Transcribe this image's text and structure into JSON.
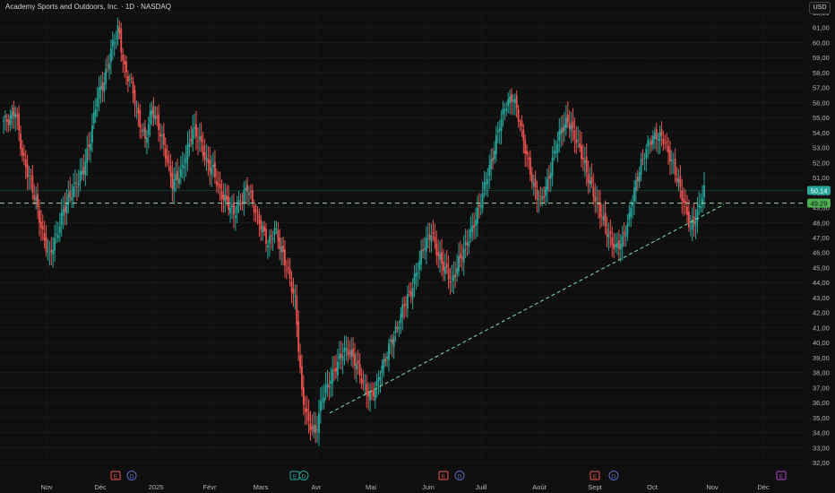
{
  "header": {
    "title": "Academy Sports and Outdoors, Inc. · 1D · NASDAQ",
    "currency_button": "USD"
  },
  "chart_data": {
    "type": "candlestick",
    "ylim": [
      32,
      62
    ],
    "y_ticks": [
      "32,00",
      "33,00",
      "34,00",
      "35,00",
      "36,00",
      "37,00",
      "38,00",
      "39,00",
      "40,00",
      "41,00",
      "42,00",
      "43,00",
      "44,00",
      "45,00",
      "46,00",
      "47,00",
      "48,00",
      "49,00",
      "50,00",
      "51,00",
      "52,00",
      "53,00",
      "54,00",
      "55,00",
      "56,00",
      "57,00",
      "58,00",
      "59,00",
      "60,00",
      "61,00",
      "62,00"
    ],
    "x_ticks": [
      "Nov",
      "Déc",
      "2025",
      "Févr",
      "Mars",
      "Avr",
      "Mai",
      "Juin",
      "Juill",
      "Août",
      "Sept",
      "Oct",
      "Nov",
      "Déc"
    ],
    "last_price_label": "50,14",
    "horizontal_level": {
      "value": 49.29,
      "label": "49,29"
    },
    "trendline": {
      "start_value": 35.3,
      "end_value": 49.2
    },
    "event_markers": [
      {
        "type": "E",
        "period": "Déc"
      },
      {
        "type": "D",
        "period": "Déc"
      },
      {
        "type": "E",
        "period": "Mars"
      },
      {
        "type": "D",
        "period": "Mars"
      },
      {
        "type": "E",
        "period": "Juin"
      },
      {
        "type": "D",
        "period": "Juin"
      },
      {
        "type": "E",
        "period": "Sept"
      },
      {
        "type": "D",
        "period": "Sept"
      },
      {
        "type": "E",
        "period": "Déc"
      }
    ],
    "price_path": [
      [
        54.8,
        55.5,
        52.5,
        51.0,
        49.4,
        47.2,
        45.6
      ],
      [
        47.0,
        48.8,
        49.8,
        50.6,
        51.6,
        53.6,
        56.5,
        57.4,
        59.5,
        60.9
      ],
      [
        58.2,
        57.3,
        55.0,
        53.5,
        55.6,
        54.4,
        52.6,
        50.6,
        51.2
      ],
      [
        52.4,
        54.2,
        53.5,
        52.0,
        51.5,
        50.0,
        49.4,
        48.6,
        49.4,
        50.4,
        49.0,
        47.8,
        46.6
      ],
      [
        47.6,
        46.2,
        44.6,
        42.8,
        36.6,
        34.6,
        34.0
      ],
      [
        36.4,
        37.3,
        38.4,
        39.4,
        39.4,
        38.6,
        37.2,
        36.4,
        37.1
      ],
      [
        38.6,
        40.0,
        41.0,
        42.6,
        43.4,
        45.0,
        46.6,
        47.3,
        45.8,
        44.9,
        44.0,
        45.4,
        46.4,
        47.6,
        49.0
      ],
      [
        50.8,
        52.4,
        54.6,
        55.9,
        56.4,
        54.6,
        52.4,
        50.4,
        49.4,
        50.6,
        52.6,
        54.2,
        54.8,
        53.8,
        52.6,
        51.0,
        49.6,
        48.4,
        47.1,
        46.3,
        46.8,
        48.3
      ],
      [
        50.6,
        52.4,
        53.4,
        53.8,
        53.6,
        52.4,
        51.0,
        49.4,
        47.6,
        48.6,
        50.14
      ]
    ]
  }
}
